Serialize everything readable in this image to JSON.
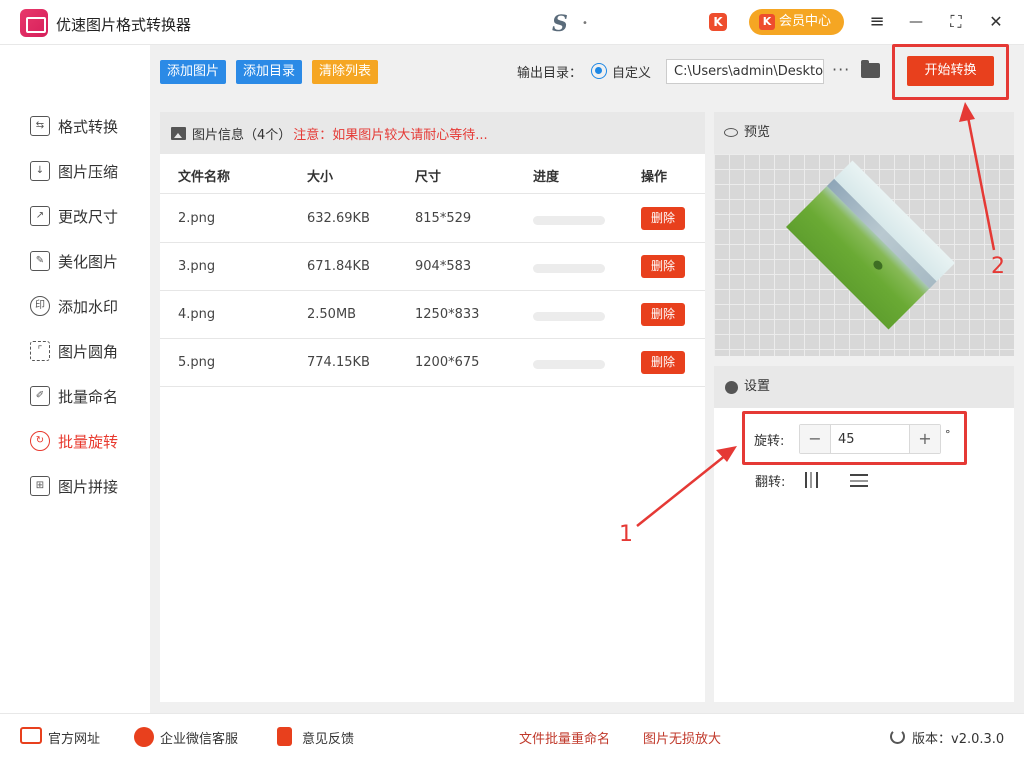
{
  "app": {
    "title": "优速图片格式转换器",
    "tb_letter": "S",
    "tb_dots": "•",
    "tb_k": "K",
    "vip_label": "会员中心",
    "menu_icon": "≡",
    "minimize_icon": "—",
    "maximize_icon": "⛶",
    "close_icon": "✕"
  },
  "sidebar": {
    "items": [
      {
        "label": "格式转换",
        "icon": "⇆"
      },
      {
        "label": "图片压缩",
        "icon": "↓"
      },
      {
        "label": "更改尺寸",
        "icon": "↗"
      },
      {
        "label": "美化图片",
        "icon": "✎"
      },
      {
        "label": "添加水印",
        "icon": "印"
      },
      {
        "label": "图片圆角",
        "icon": "⌜"
      },
      {
        "label": "批量命名",
        "icon": "✐"
      },
      {
        "label": "批量旋转",
        "icon": "↻"
      },
      {
        "label": "图片拼接",
        "icon": "⊞"
      }
    ],
    "active": "批量旋转"
  },
  "toolbar": {
    "add_image": "添加图片",
    "add_folder": "添加目录",
    "clear_list": "清除列表",
    "output_label": "输出目录：",
    "custom_label": "自定义",
    "output_path": "C:\\Users\\admin\\Deskto",
    "more": "···",
    "start": "开始转换"
  },
  "file_list": {
    "header": "图片信息（4个）",
    "warning": "注意：如果图片较大请耐心等待...",
    "columns": [
      "文件名称",
      "大小",
      "尺寸",
      "进度",
      "操作"
    ],
    "rows": [
      {
        "name": "2.png",
        "size": "632.69KB",
        "dims": "815*529",
        "progress": 0,
        "action": "删除"
      },
      {
        "name": "3.png",
        "size": "671.84KB",
        "dims": "904*583",
        "progress": 0,
        "action": "删除"
      },
      {
        "name": "4.png",
        "size": "2.50MB",
        "dims": "1250*833",
        "progress": 0,
        "action": "删除"
      },
      {
        "name": "5.png",
        "size": "774.15KB",
        "dims": "1200*675",
        "progress": 0,
        "action": "删除"
      }
    ]
  },
  "preview": {
    "title": "预览"
  },
  "settings": {
    "title": "设置",
    "rotate_label": "旋转:",
    "rotate_value": "45",
    "minus": "−",
    "plus": "+",
    "degree": "°",
    "flip_label": "翻转:"
  },
  "annotations": {
    "one": "1",
    "two": "2"
  },
  "footer": {
    "website": "官方网址",
    "wechat": "企业微信客服",
    "feedback": "意见反馈",
    "rename": "文件批量重命名",
    "enlarge": "图片无损放大",
    "version": "版本：v2.0.3.0"
  },
  "colors": {
    "accent_red": "#e8401d",
    "blue_btn": "#2b8ae6",
    "orange_btn": "#f5a623",
    "annotation_red": "#e53935"
  }
}
